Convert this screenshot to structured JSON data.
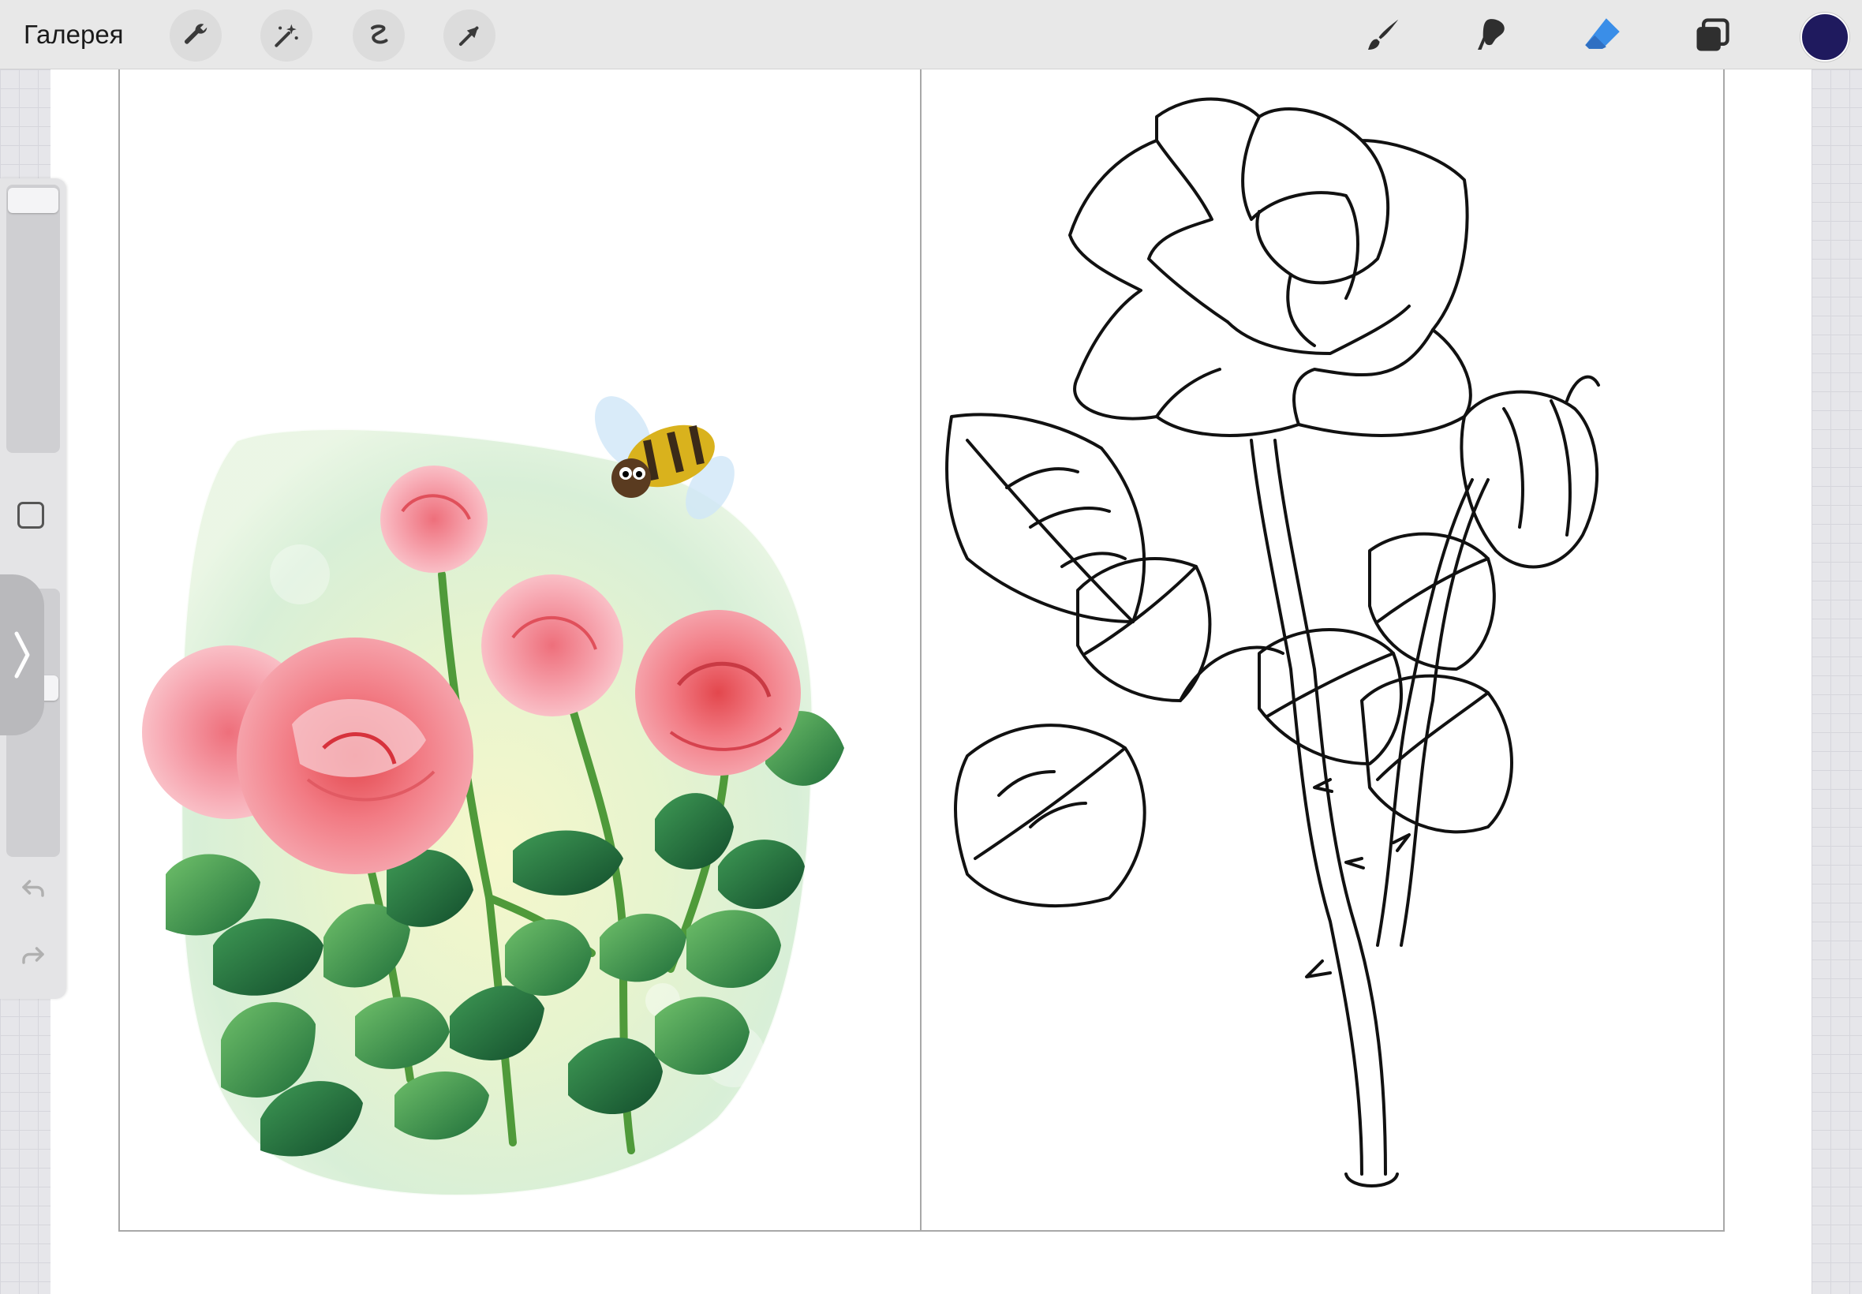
{
  "toolbar": {
    "gallery_label": "Галерея",
    "left_tools": [
      "wrench-icon",
      "magic-wand-icon",
      "selection-s-icon",
      "arrow-icon"
    ],
    "right_tools": [
      "brush-icon",
      "smudge-icon",
      "eraser-icon",
      "layers-icon"
    ],
    "active_tool": "eraser-icon",
    "active_color": "#1f1a5e",
    "eraser_color": "#3a8ee8"
  },
  "sidebar": {
    "items": [
      "size-slider",
      "modify-button",
      "opacity-slider",
      "undo-icon",
      "redo-icon"
    ]
  },
  "canvas": {
    "left_page": "color-rose-illustration",
    "right_page": "rose-line-drawing"
  }
}
